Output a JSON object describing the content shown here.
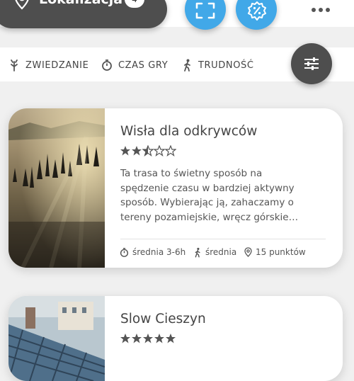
{
  "header": {
    "location_label": "Lokalizacja",
    "location_count": "4",
    "icons": [
      "location-pin-icon",
      "scan-icon",
      "discount-icon",
      "more-icon"
    ]
  },
  "filters": [
    {
      "label": "ZWIEDZANIE",
      "icon": "sightseeing-icon"
    },
    {
      "label": "CZAS GRY",
      "icon": "stopwatch-icon"
    },
    {
      "label": "TRUDNOŚĆ",
      "icon": "walker-icon"
    }
  ],
  "routes": [
    {
      "title": "Wisła dla odkrywców",
      "rating": 2.5,
      "rating_max": 5,
      "description": "Ta trasa to świetny sposób na spędzenie czasu w bardziej aktywny sposób. Wybierając ją, zahaczamy o tereny pozamiejskie, wręcz górskie…",
      "time": "średnia 3-6h",
      "difficulty": "średnia",
      "points": "15 punktów"
    },
    {
      "title": "Slow Cieszyn",
      "rating": 5,
      "rating_max": 5
    }
  ],
  "colors": {
    "accent_blue": "#41a8e8",
    "dark_pill": "#4e4e4e",
    "background": "#f0f0f0",
    "star": "#555555"
  }
}
